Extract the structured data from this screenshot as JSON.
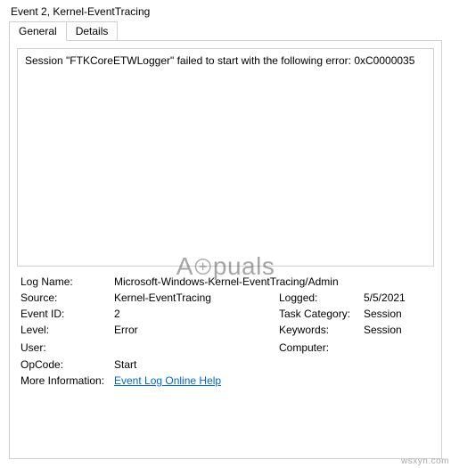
{
  "title": "Event 2, Kernel-EventTracing",
  "tabs": {
    "general": "General",
    "details": "Details"
  },
  "message": "Session \"FTKCoreETWLogger\" failed to start with the following error: 0xC0000035",
  "labels": {
    "log_name": "Log Name:",
    "source": "Source:",
    "event_id": "Event ID:",
    "level": "Level:",
    "user": "User:",
    "opcode": "OpCode:",
    "more_info": "More Information:",
    "logged": "Logged:",
    "task_category": "Task Category:",
    "keywords": "Keywords:",
    "computer": "Computer:"
  },
  "values": {
    "log_name": "Microsoft-Windows-Kernel-EventTracing/Admin",
    "source": "Kernel-EventTracing",
    "event_id": "2",
    "level": "Error",
    "user": "",
    "opcode": "Start",
    "logged": "5/5/2021",
    "task_category": "Session",
    "keywords": "Session",
    "computer": "",
    "more_info_link": "Event Log Online Help"
  },
  "watermark": "Appuals",
  "corner": "wsxyn.com"
}
